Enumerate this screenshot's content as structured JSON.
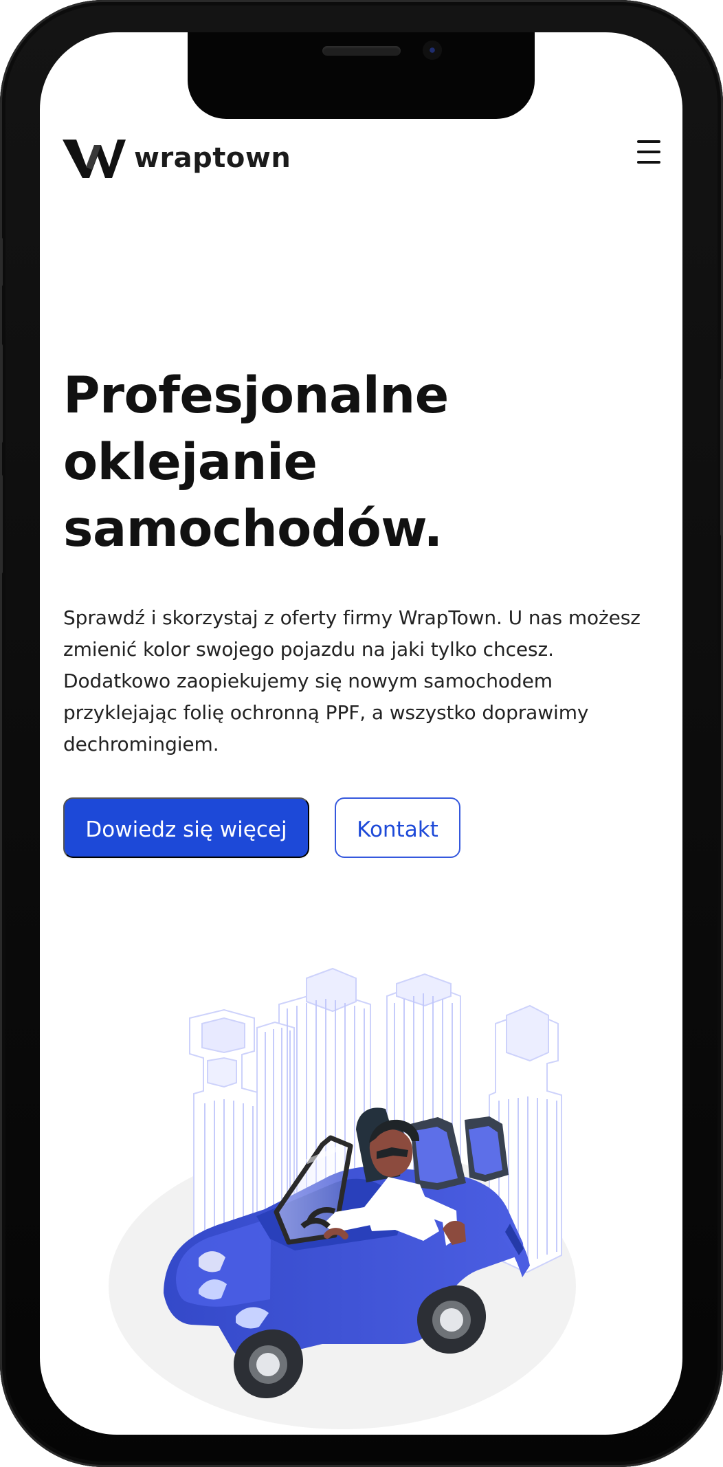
{
  "header": {
    "brand": "wraptown"
  },
  "hero": {
    "title_lines": [
      "Profesjonalne",
      "oklejanie",
      "samochodów."
    ],
    "description_lines": [
      "Sprawdź i skorzystaj z oferty firmy WrapTown. U nas możesz",
      "zmienić kolor swojego pojazdu na jaki tylko chcesz.",
      "Dodatkowo zaopiekujemy się nowym samochodem",
      "przyklejając folię ochronną PPF, a wszystko doprawimy",
      "dechromingiem."
    ],
    "primary_button": "Dowiedz się więcej",
    "secondary_button": "Kontakt"
  },
  "theme": {
    "accent": "#1d49d8",
    "text": "#111111",
    "background": "#ffffff",
    "illustration_blue": "#3b4ed3",
    "building_lilac": "#c9cff7"
  },
  "icons": {
    "menu": "hamburger-icon",
    "logo": "wraptown-logo"
  }
}
